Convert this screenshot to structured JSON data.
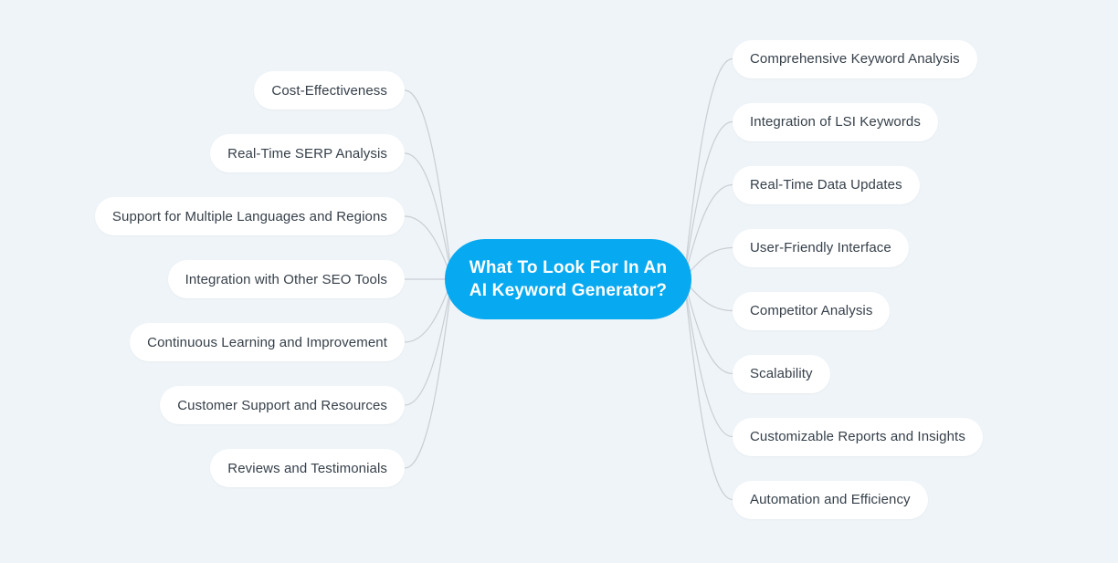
{
  "diagram": {
    "title": "What To Look For In An AI Keyword Generator?",
    "type": "mind-map",
    "background_color": "#eff4f8",
    "connector_color": "#c8ced4"
  },
  "hub": {
    "line1": "What To Look For In An",
    "line2": "AI Keyword Generator?",
    "fill_color": "#07a9f0",
    "text_color": "#ffffff"
  },
  "branches": {
    "left": [
      {
        "label": "Cost-Effectiveness"
      },
      {
        "label": "Real-Time SERP Analysis"
      },
      {
        "label": "Support for Multiple Languages and Regions"
      },
      {
        "label": "Integration with Other SEO Tools"
      },
      {
        "label": "Continuous Learning and Improvement"
      },
      {
        "label": "Customer Support and Resources"
      },
      {
        "label": "Reviews and Testimonials"
      }
    ],
    "right": [
      {
        "label": "Comprehensive Keyword Analysis"
      },
      {
        "label": "Integration of LSI Keywords"
      },
      {
        "label": "Real-Time Data Updates"
      },
      {
        "label": "User-Friendly Interface"
      },
      {
        "label": "Competitor Analysis"
      },
      {
        "label": "Scalability"
      },
      {
        "label": "Customizable Reports and Insights"
      },
      {
        "label": "Automation and Efficiency"
      }
    ]
  },
  "node_style": {
    "fill_color": "#ffffff",
    "text_color": "#36404a"
  }
}
